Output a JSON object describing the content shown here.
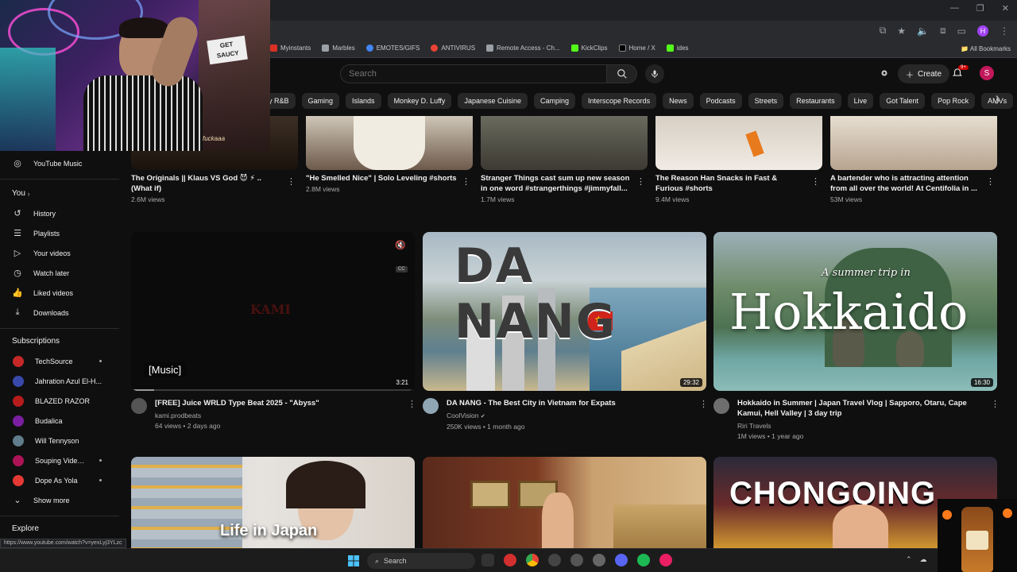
{
  "browser": {
    "bookmarks": [
      "Myinstants",
      "Marbles",
      "EMOTES/GIFS",
      "ANTIVIRUS",
      "Remote Access - Ch...",
      "KickClips",
      "Home / X",
      "ides"
    ],
    "all_bookmarks": "All Bookmarks",
    "profile_letter": "H",
    "status_url": "https://www.youtube.com/watch?v=yexLyj3YLzc"
  },
  "header": {
    "search_placeholder": "Search",
    "create_label": "Create",
    "notif_badge": "9+",
    "avatar_letter": "S"
  },
  "chips": [
    "ary R&B",
    "Gaming",
    "Islands",
    "Monkey D. Luffy",
    "Japanese Cuisine",
    "Camping",
    "Interscope Records",
    "News",
    "Podcasts",
    "Streets",
    "Restaurants",
    "Live",
    "Got Talent",
    "Pop Rock",
    "AMVs"
  ],
  "webcam": {
    "sign_line1": "GET",
    "sign_line2": "SAUCY",
    "shirt_text": "fuckaaa"
  },
  "sidebar": {
    "youtube_music": "YouTube Music",
    "you_heading": "You",
    "you_items": [
      "History",
      "Playlists",
      "Your videos",
      "Watch later",
      "Liked videos",
      "Downloads"
    ],
    "subscriptions_heading": "Subscriptions",
    "subscriptions": [
      "TechSource",
      "Jahration Azul El-H...",
      "BLAZED RAZOR",
      "Budalica",
      "Will Tennyson",
      "Souping Videoga...",
      "Dope As Yola"
    ],
    "show_more": "Show more",
    "explore_heading": "Explore"
  },
  "top_row": [
    {
      "title": "The Originals || Klaus VS God 😈 ⚡ .. (What if)",
      "meta": "2.6M views"
    },
    {
      "title": "\"He Smelled Nice\" | Solo Leveling #shorts",
      "meta": "2.8M views"
    },
    {
      "title": "Stranger Things cast sum up new season in one word #strangerthings #jimmyfall...",
      "meta": "1.7M views"
    },
    {
      "title": "The Reason Han Snacks in Fast & Furious #shorts",
      "meta": "9.4M views"
    },
    {
      "title": "A bartender who is attracting attention from all over the world! At Centifolia in ...",
      "meta": "53M views"
    }
  ],
  "mid_row": [
    {
      "title": "[FREE] Juice WRLD Type Beat 2025 - \"Abyss\"",
      "channel": "kami.prodbeats",
      "meta": "64 views • 2 days ago",
      "duration": "3:21",
      "caption": "[Music]",
      "logo": "KAMI",
      "cc": "CC"
    },
    {
      "title": "DA NANG - The Best City in Vietnam for Expats",
      "channel": "CoolVision",
      "meta": "250K views • 1 month ago",
      "duration": "29:32",
      "overlay": "DA NANG"
    },
    {
      "title": "Hokkaido in Summer | Japan Travel Vlog | Sapporo, Otaru, Cape Kamui, Hell Valley | 3 day trip",
      "channel": "Riri Travels",
      "meta": "1M views • 1 year ago",
      "duration": "16:30",
      "overlay_small": "A summer trip in",
      "overlay": "Hokkaido"
    }
  ],
  "bottom_row": [
    {
      "overlay": "Life in Japan"
    },
    {
      "overlay": ""
    },
    {
      "overlay": "CHONGQING"
    }
  ],
  "taskbar": {
    "search_label": "Search"
  }
}
